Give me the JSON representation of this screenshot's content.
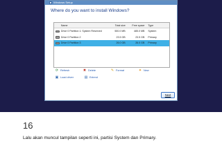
{
  "window": {
    "title": "Windows Setup"
  },
  "heading": "Where do you want to install Windows?",
  "table": {
    "columns": [
      "Name",
      "Total size",
      "Free space",
      "Type"
    ],
    "rows": [
      {
        "name": "Drive 0 Partition 1: System Reserved",
        "total": "500.0 MB",
        "free": "485.0 MB",
        "type": "System",
        "selected": false
      },
      {
        "name": "Drive 0 Partition 2",
        "total": "23.5 GB",
        "free": "23.5 GB",
        "type": "Primary",
        "selected": false
      },
      {
        "name": "Drive 0 Partition 3",
        "total": "26.0 GB",
        "free": "26.0 GB",
        "type": "Primary",
        "selected": true
      }
    ]
  },
  "actions": {
    "refresh": "Refresh",
    "delete": "Delete",
    "format": "Format",
    "new": "New",
    "load_driver": "Load driver",
    "extend": "Extend"
  },
  "next_button": "Next",
  "slide_number": "16",
  "caption": "Lalu akan muncul tampilan seperti ini, partisi System dan Primary.",
  "colors": {
    "selection": "#3fb0e6",
    "heading": "#1b3e8a",
    "link": "#1f56b0",
    "background": "#1c1c4a"
  }
}
